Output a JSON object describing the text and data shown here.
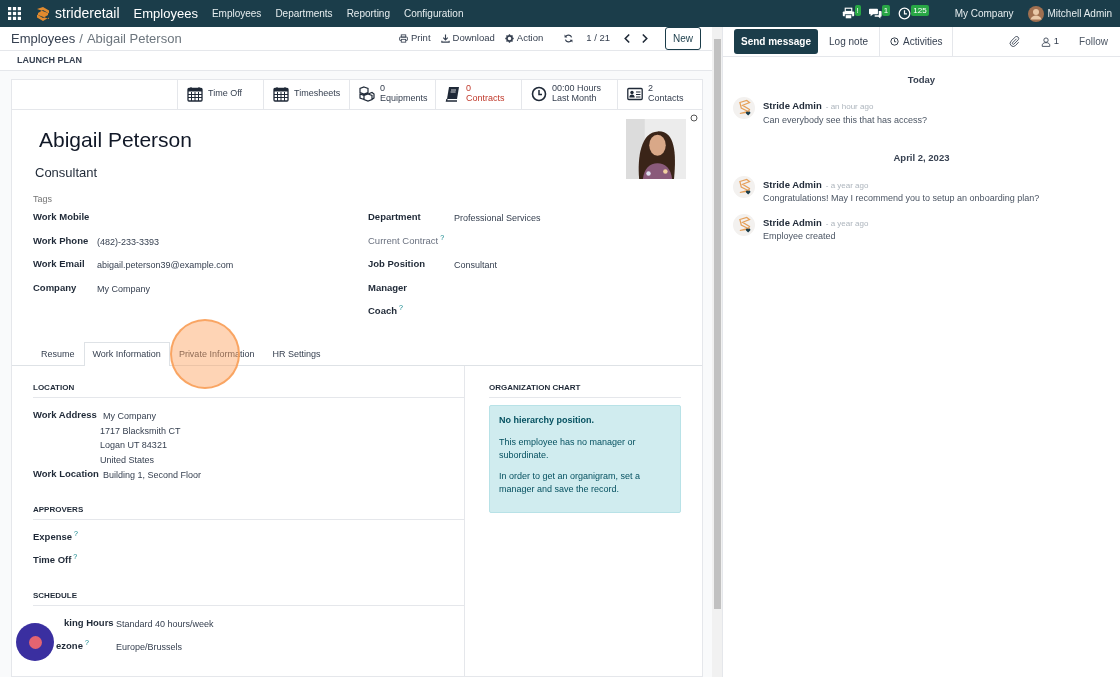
{
  "navbar": {
    "brand": "strideretail",
    "app": "Employees",
    "menu": [
      "Employees",
      "Departments",
      "Reporting",
      "Configuration"
    ],
    "systray": [
      {
        "kind": "printer",
        "badge": "!"
      },
      {
        "kind": "chat",
        "badge": "1"
      },
      {
        "kind": "clock",
        "badge": "125"
      }
    ],
    "company": "My Company",
    "user": "Mitchell Admin"
  },
  "control_panel": {
    "breadcrumb": [
      "Employees",
      "Abigail Peterson"
    ],
    "separator": "/",
    "actions": [
      {
        "kind": "print",
        "label": "Print"
      },
      {
        "kind": "download",
        "label": "Download"
      },
      {
        "kind": "gear",
        "label": "Action"
      }
    ],
    "pager": "1 / 21",
    "new_button": "New"
  },
  "statusbar": {
    "buttons": [
      "LAUNCH PLAN"
    ]
  },
  "stat_buttons": [
    {
      "kind": "calendar",
      "label": "Time Off",
      "warning": false
    },
    {
      "kind": "calendar",
      "label": "Timesheets",
      "warning": false
    },
    {
      "kind": "cubes",
      "value": "0",
      "label": "Equipments",
      "warning": false
    },
    {
      "kind": "book",
      "value": "0",
      "label": "Contracts",
      "warning": true
    },
    {
      "kind": "clock",
      "value": "00:00 Hours",
      "label": "Last Month",
      "warning": false
    },
    {
      "kind": "card",
      "value": "2",
      "label": "Contacts",
      "warning": false
    }
  ],
  "employee": {
    "name": "Abigail Peterson",
    "job_title": "Consultant",
    "tags_placeholder": "Tags"
  },
  "fields_left": [
    {
      "label": "Work Mobile"
    },
    {
      "label": "Work Phone",
      "value": "(482)-233-3393"
    },
    {
      "label": "Work Email",
      "value": "abigail.peterson39@example.com"
    },
    {
      "label": "Company",
      "value": "My Company"
    }
  ],
  "fields_right": [
    {
      "label": "Department",
      "value": "Professional Services",
      "muted": false
    },
    {
      "label": "Current Contract",
      "help": "?",
      "muted": true
    },
    {
      "label": "Job Position",
      "value": "Consultant",
      "muted": false
    },
    {
      "label": "Manager",
      "muted": false
    },
    {
      "label": "Coach",
      "help": "?",
      "muted": false
    }
  ],
  "tabs": [
    {
      "label": "Resume",
      "selected": false
    },
    {
      "label": "Work Information",
      "selected": true
    },
    {
      "label": "Private Information",
      "selected": false
    },
    {
      "label": "HR Settings",
      "selected": false
    }
  ],
  "sections": [
    {
      "title": "LOCATION",
      "fields": [
        {
          "label": "Work Address",
          "lines": [
            "My Company",
            "1717 Blacksmith CT",
            "Logan UT 84321",
            "United States"
          ]
        },
        {
          "label": "Work Location",
          "lines": [
            "Building 1, Second Floor"
          ]
        }
      ]
    },
    {
      "title": "APPROVERS",
      "fields": [
        {
          "label": "Expense",
          "help": "?"
        },
        {
          "label": "Time Off",
          "help": "?"
        }
      ]
    },
    {
      "title": "SCHEDULE",
      "fields": [
        {
          "label": "king Hours",
          "lines": [
            "Standard 40 hours/week"
          ]
        },
        {
          "label": "ezone",
          "help": "?",
          "lines": [
            "Europe/Brussels"
          ]
        }
      ]
    }
  ],
  "org_chart": {
    "title": "ORGANIZATION CHART",
    "heading": "No hierarchy position.",
    "paragraphs": [
      "This employee has no manager or subordinate.",
      "In order to get an organigram, set a manager and save the record."
    ]
  },
  "chatter": {
    "buttons": [
      {
        "label": "Send message",
        "selected": true
      },
      {
        "label": "Log note",
        "selected": false
      }
    ],
    "activities": "Activities",
    "followers": "1",
    "follow": "Follow",
    "groups": [
      {
        "date": "Today",
        "messages": [
          {
            "author": "Stride Admin",
            "time": "- an hour ago",
            "body": "Can everybody see this that has access?"
          }
        ]
      },
      {
        "date": "April 2, 2023",
        "messages": [
          {
            "author": "Stride Admin",
            "time": "- a year ago",
            "body": "Congratulations! May I recommend you to setup an onboarding plan?"
          },
          {
            "author": "Stride Admin",
            "time": "- a year ago",
            "body": "Employee created"
          }
        ]
      }
    ]
  }
}
